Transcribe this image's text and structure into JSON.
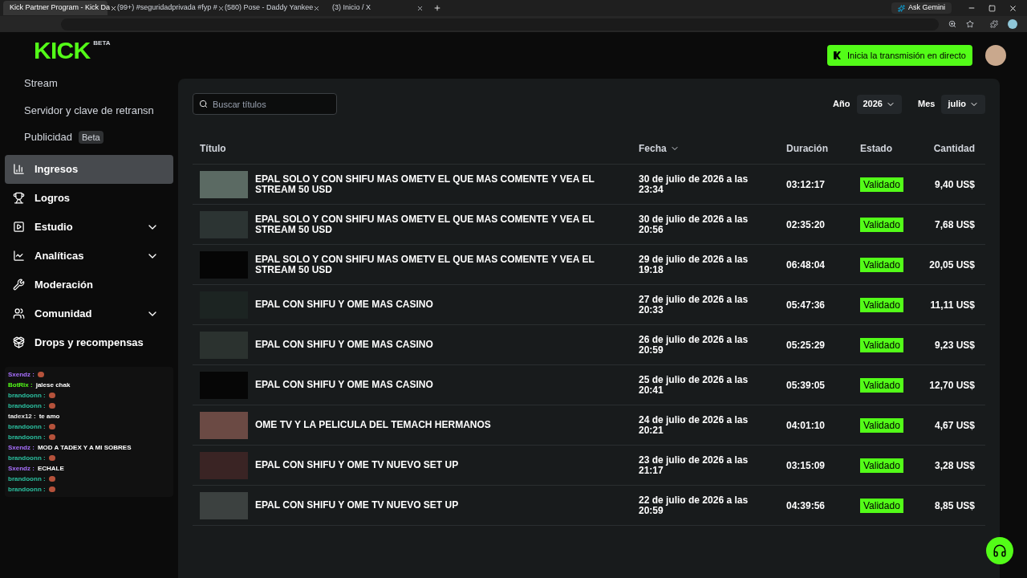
{
  "browser": {
    "tabs": [
      {
        "title": "Kick Partner Program - Kick Da",
        "selected": true
      },
      {
        "title": "(99+) #seguridadprivada #fyp #",
        "selected": false
      },
      {
        "title": "(580) Pose - Daddy Yankee",
        "selected": false
      },
      {
        "title": "(3) Inicio / X",
        "selected": false
      }
    ],
    "ask": "Ask Gemini"
  },
  "sidebar": {
    "logo": "KICK",
    "logo_badge": "BETA",
    "top_items": [
      {
        "label": "Stream"
      },
      {
        "label": "Servidor y clave de retransn"
      },
      {
        "label": "Publicidad",
        "badge": "Beta"
      }
    ],
    "items": [
      {
        "label": "Ingresos",
        "selected": true
      },
      {
        "label": "Logros",
        "selected": false
      },
      {
        "label": "Estudio",
        "selected": false,
        "expanded": false
      },
      {
        "label": "Analíticas",
        "selected": false,
        "expanded": false
      },
      {
        "label": "Moderación",
        "selected": false
      },
      {
        "label": "Comunidad",
        "selected": false,
        "expanded": false
      },
      {
        "label": "Drops y recompensas",
        "selected": false
      }
    ]
  },
  "chat": [
    {
      "user": "Sxendz :",
      "color": "#a970ff"
    },
    {
      "user": "BotRix :",
      "message": "jalese chak",
      "color": "#53fc18"
    },
    {
      "user": "brandoonn :",
      "color": "#2bc0a0"
    },
    {
      "user": "brandoonn :",
      "color": "#2bc0a0"
    },
    {
      "user": "tadex12 :",
      "message": "te amo",
      "color": "#e6e6e6"
    },
    {
      "user": "brandoonn :",
      "color": "#2bc0a0"
    },
    {
      "user": "brandoonn :",
      "color": "#2bc0a0"
    },
    {
      "user": "Sxendz :",
      "message": "MOD A TADEX Y A MI SOBRES",
      "color": "#a970ff"
    },
    {
      "user": "brandoonn :",
      "color": "#2bc0a0"
    },
    {
      "user": "Sxendz :",
      "message": "ECHALE",
      "color": "#a970ff"
    },
    {
      "user": "brandoonn :",
      "color": "#2bc0a0"
    },
    {
      "user": "brandoonn :",
      "color": "#2bc0a0"
    }
  ],
  "header": {
    "cta": "Inicia la transmisión en directo"
  },
  "filters": {
    "search_placeholder": "Buscar títulos",
    "year_label": "Año",
    "year": "2026",
    "month_label": "Mes",
    "month": "julio"
  },
  "table": {
    "columns": [
      {
        "label": "Título",
        "sorted": false
      },
      {
        "label": "Fecha",
        "sorted": true
      },
      {
        "label": "Duración",
        "sorted": false
      },
      {
        "label": "Estado",
        "sorted": false
      },
      {
        "label": "Cantidad",
        "sorted": false
      }
    ],
    "rows": [
      {
        "title": "EPAL SOLO Y CON SHIFU MAS OMETV EL QUE MAS COMENTE Y VEA EL STREAM 50 USD",
        "date": "30 de julio de 2026 a las 23:34",
        "duration": "03:12:17",
        "status": "Validado",
        "amount": "9,40 US$"
      },
      {
        "title": "EPAL SOLO Y CON SHIFU MAS OMETV EL QUE MAS COMENTE Y VEA EL STREAM 50 USD",
        "date": "30 de julio de 2026 a las 20:56",
        "duration": "02:35:20",
        "status": "Validado",
        "amount": "7,68 US$"
      },
      {
        "title": "EPAL SOLO Y CON SHIFU MAS OMETV EL QUE MAS COMENTE Y VEA EL STREAM 50 USD",
        "date": "29 de julio de 2026 a las 19:18",
        "duration": "06:48:04",
        "status": "Validado",
        "amount": "20,05 US$"
      },
      {
        "title": "EPAL CON SHIFU Y OME MAS CASINO",
        "date": "27 de julio de 2026 a las 20:33",
        "duration": "05:47:36",
        "status": "Validado",
        "amount": "11,11 US$"
      },
      {
        "title": "EPAL CON SHIFU Y OME MAS CASINO",
        "date": "26 de julio de 2026 a las 20:59",
        "duration": "05:25:29",
        "status": "Validado",
        "amount": "9,23 US$"
      },
      {
        "title": "EPAL CON SHIFU Y OME MAS CASINO",
        "date": "25 de julio de 2026 a las 20:41",
        "duration": "05:39:05",
        "status": "Validado",
        "amount": "12,70 US$"
      },
      {
        "title": "OME TV Y LA PELICULA DEL TEMACH HERMANOS",
        "date": "24 de julio de 2026 a las 20:21",
        "duration": "04:01:10",
        "status": "Validado",
        "amount": "4,67 US$"
      },
      {
        "title": "EPAL CON SHIFU Y OME TV NUEVO SET UP",
        "date": "23 de julio de 2026 a las 21:17",
        "duration": "03:15:09",
        "status": "Validado",
        "amount": "3,28 US$"
      },
      {
        "title": "EPAL CON SHIFU Y OME TV NUEVO SET UP",
        "date": "22 de julio de 2026 a las 20:59",
        "duration": "04:39:56",
        "status": "Validado",
        "amount": "8,85 US$"
      }
    ]
  }
}
